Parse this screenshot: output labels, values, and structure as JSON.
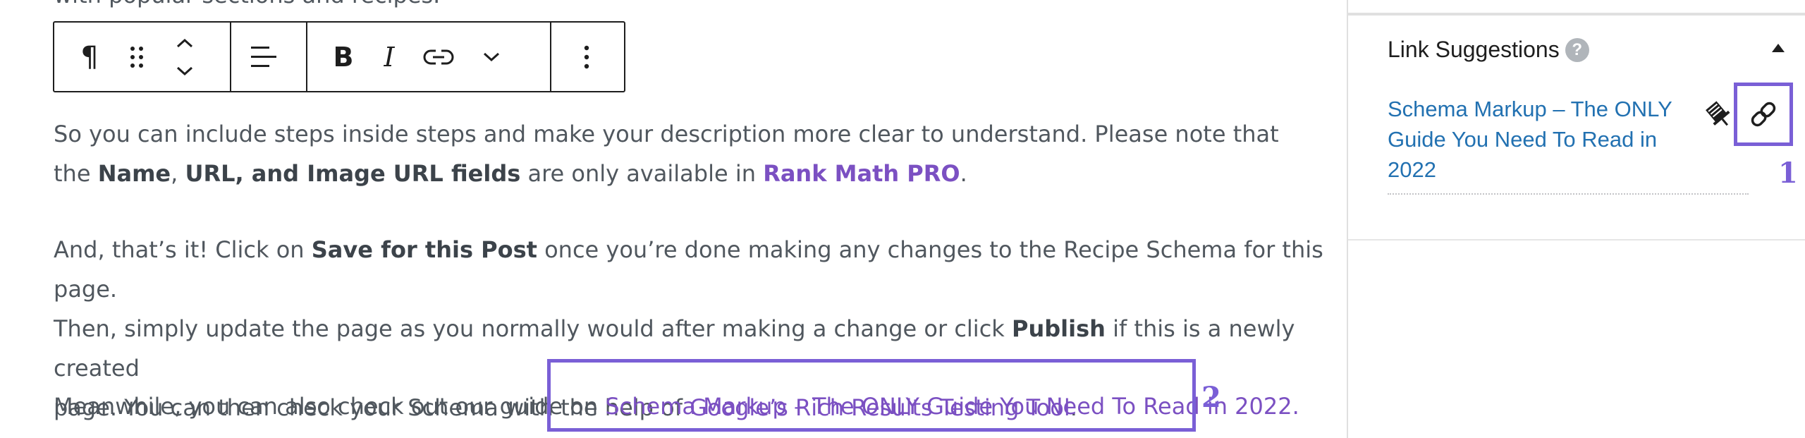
{
  "editor": {
    "cut_line": "with popular sections and recipes.",
    "toolbar": {
      "paragraph_icon": "pilcrow-icon",
      "drag_icon": "drag-handle-icon",
      "move_icon": "move-up-down-icon",
      "align_icon": "align-left-icon",
      "bold_label": "B",
      "italic_label": "I",
      "link_icon": "link-icon",
      "more_formatting_icon": "chevron-down-icon",
      "options_icon": "more-vertical-icon"
    },
    "para1": {
      "line1": "So you can include steps inside steps and make your description more clear to understand. Please note that",
      "line2_pre": "the ",
      "line2_b1": "Name",
      "line2_mid1": ", ",
      "line2_b2": "URL, and Image URL fields",
      "line2_mid2": " are only available in ",
      "line2_link": "Rank Math PRO",
      "line2_post": "."
    },
    "para2": {
      "line1_pre": "And, that’s it! Click on ",
      "line1_b": "Save for this Post",
      "line1_post": " once you’re done making any changes to the Recipe Schema for this page.",
      "line2_pre": "Then, simply update the page as you normally would after making a change or click ",
      "line2_b": "Publish",
      "line2_post": " if this is a newly created",
      "line3_pre": "page. You can then check your Schema with the help of ",
      "line3_link": "Google’s Rich Results Testing Tool",
      "line3_post": "."
    },
    "para3": {
      "pre": "Meanwhile, you can also check out our guide on ",
      "link": "Schema Markup – The ONLY Guide You Need To Read in 2022.",
      "callout": "2"
    }
  },
  "sidebar": {
    "title": "Link Suggestions",
    "help_icon": "?",
    "collapse_icon": "caret-up-icon",
    "suggestion": {
      "line1": "Schema Markup – The ONLY",
      "line2": "Guide You Need To Read in",
      "line3": "2022",
      "pin_icon": "pin-icon",
      "insert_link_icon": "link-icon"
    },
    "callout": "1"
  },
  "colors": {
    "text": "#50575e",
    "accent_purple": "#7b50c2",
    "highlight": "#7a5fd6",
    "link_blue": "#2271b1"
  }
}
